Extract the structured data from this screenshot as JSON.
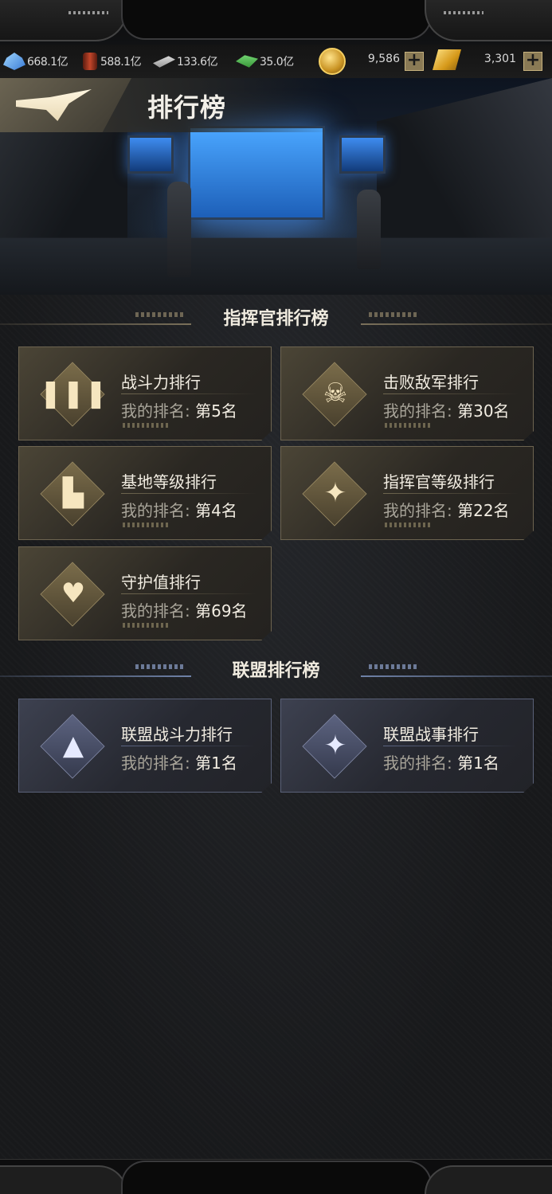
{
  "resources": {
    "crystal": "668.1亿",
    "oil": "588.1亿",
    "steel": "133.6亿",
    "cash": "35.0亿",
    "coins": "9,586",
    "gold": "3,301",
    "plus_label": "+"
  },
  "header": {
    "title": "排行榜"
  },
  "commander_section": {
    "title": "指挥官排行榜",
    "cards": [
      {
        "title": "战斗力排行",
        "rank_label": "我的排名: ",
        "rank_value": "第5名",
        "icon": "bullets-icon",
        "glyph": "❚❚❚"
      },
      {
        "title": "击败敌军排行",
        "rank_label": "我的排名: ",
        "rank_value": "第30名",
        "icon": "skull-helmet-icon",
        "glyph": "☠"
      },
      {
        "title": "基地等级排行",
        "rank_label": "我的排名: ",
        "rank_value": "第4名",
        "icon": "base-building-icon",
        "glyph": "▙"
      },
      {
        "title": "指挥官等级排行",
        "rank_label": "我的排名: ",
        "rank_value": "第22名",
        "icon": "winged-chevron-icon",
        "glyph": "✦"
      },
      {
        "title": "守护值排行",
        "rank_label": "我的排名: ",
        "rank_value": "第69名",
        "icon": "winged-heart-icon",
        "glyph": "♥"
      }
    ]
  },
  "alliance_section": {
    "title": "联盟排行榜",
    "cards": [
      {
        "title": "联盟战斗力排行",
        "rank_label": "我的排名: ",
        "rank_value": "第1名",
        "icon": "winged-bullet-icon",
        "glyph": "▲"
      },
      {
        "title": "联盟战事排行",
        "rank_label": "我的排名: ",
        "rank_value": "第1名",
        "icon": "winged-emblem-icon",
        "glyph": "✦"
      }
    ]
  },
  "colors": {
    "gold_accent": "#c9a968",
    "blue_accent": "#6f82a8",
    "background": "#1a1b1d"
  }
}
